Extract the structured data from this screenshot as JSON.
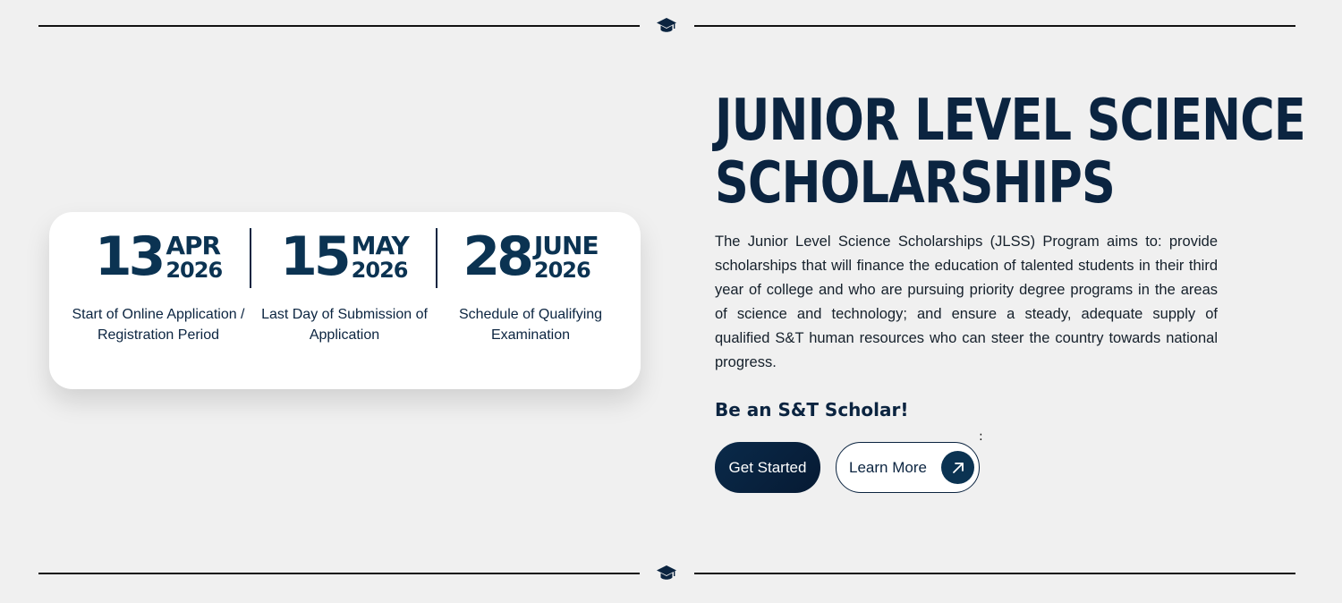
{
  "icons": {
    "top_divider": "graduation-cap-icon",
    "bottom_divider": "graduation-cap-icon",
    "learn_more": "arrow-up-right-icon"
  },
  "colors": {
    "background": "#f0f0f0",
    "primary_navy": "#0b2440",
    "card": "#ffffff"
  },
  "dates": [
    {
      "day": "13",
      "month": "APR",
      "year": "2026",
      "description": "Start of Online Application / Registration Period"
    },
    {
      "day": "15",
      "month": "MAY",
      "year": "2026",
      "description": "Last Day of Submission of Application"
    },
    {
      "day": "28",
      "month": "JUNE",
      "year": "2026",
      "description": "Schedule of Qualifying Examination"
    }
  ],
  "hero": {
    "title_line1": "JUNIOR LEVEL SCIENCE",
    "title_line2": "SCHOLARSHIPS",
    "description": "The Junior Level Science Scholarships (JLSS) Program aims to: provide scholarships that will finance the education of talented students in their third year of college and who are pursuing priority degree programs in the areas of science and technology; and ensure a steady, adequate supply of qualified S&T human resources who can steer the country towards national progress.",
    "tagline": "Be an S&T Scholar!",
    "marker": ":"
  },
  "buttons": {
    "get_started": "Get Started",
    "learn_more": "Learn More"
  }
}
